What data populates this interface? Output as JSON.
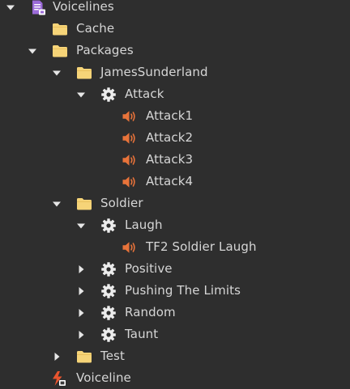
{
  "colors": {
    "background": "#2e2e2e",
    "text": "#d6d6d6",
    "folder": "#f6d478",
    "sound": "#e8733a",
    "gear": "#ececec",
    "module": "#9b6bd8",
    "script_bolt": "#e8542e"
  },
  "tree": {
    "voicelines": {
      "label": "Voicelines",
      "icon": "module-script-icon",
      "expanded": true
    },
    "cache": {
      "label": "Cache",
      "icon": "folder-icon"
    },
    "packages": {
      "label": "Packages",
      "icon": "folder-icon",
      "expanded": true
    },
    "james": {
      "label": "JamesSunderland",
      "icon": "folder-icon",
      "expanded": true
    },
    "attack": {
      "label": "Attack",
      "icon": "gear-icon",
      "expanded": true
    },
    "attack1": {
      "label": "Attack1",
      "icon": "sound-icon"
    },
    "attack2": {
      "label": "Attack2",
      "icon": "sound-icon"
    },
    "attack3": {
      "label": "Attack3",
      "icon": "sound-icon"
    },
    "attack4": {
      "label": "Attack4",
      "icon": "sound-icon"
    },
    "soldier": {
      "label": "Soldier",
      "icon": "folder-icon",
      "expanded": true
    },
    "laugh": {
      "label": "Laugh",
      "icon": "gear-icon",
      "expanded": true
    },
    "tf2_laugh": {
      "label": "TF2 Soldier Laugh",
      "icon": "sound-icon"
    },
    "positive": {
      "label": "Positive",
      "icon": "gear-icon",
      "expanded": false
    },
    "pushing": {
      "label": "Pushing The Limits",
      "icon": "gear-icon",
      "expanded": false
    },
    "random": {
      "label": "Random",
      "icon": "gear-icon",
      "expanded": false
    },
    "taunt": {
      "label": "Taunt",
      "icon": "gear-icon",
      "expanded": false
    },
    "test": {
      "label": "Test",
      "icon": "folder-icon",
      "expanded": false
    },
    "voiceline": {
      "label": "Voiceline",
      "icon": "local-script-icon"
    }
  }
}
